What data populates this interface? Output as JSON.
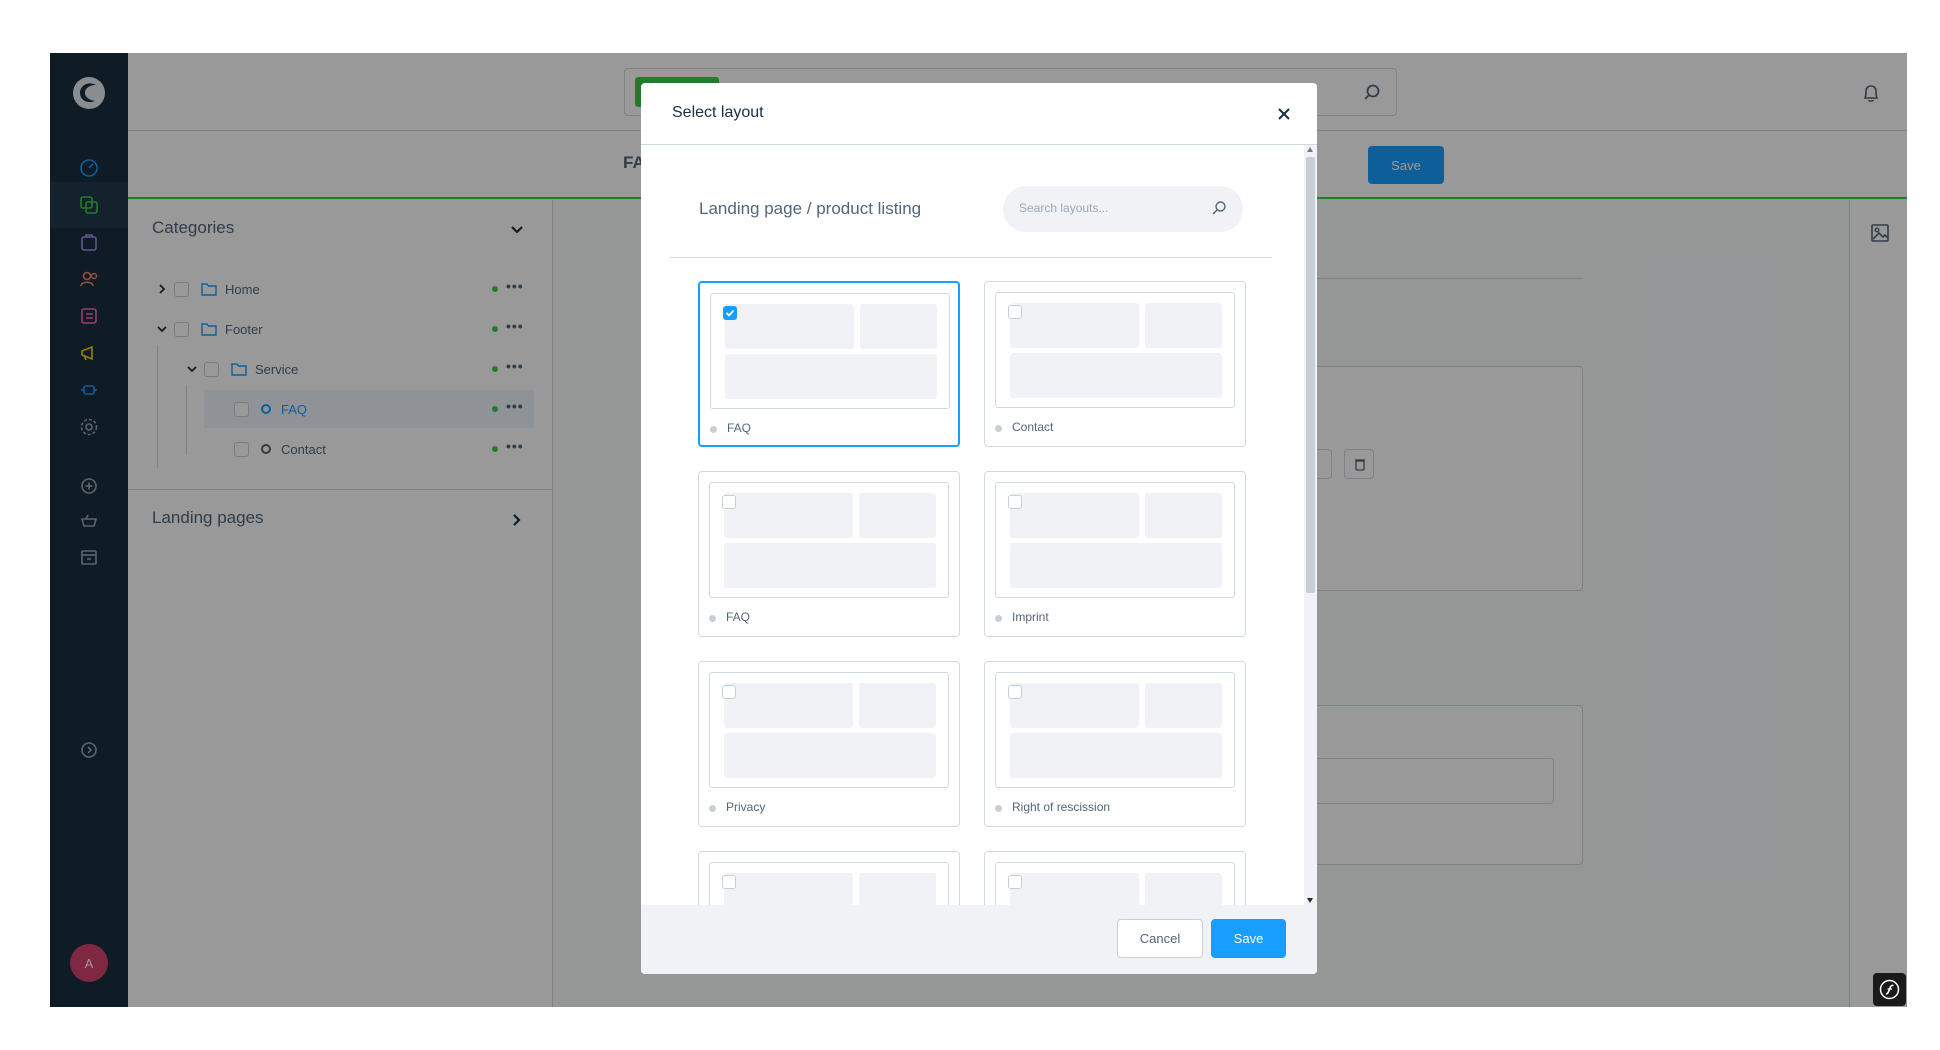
{
  "header": {
    "page_title": "FA",
    "save_label": "Save"
  },
  "tree": {
    "categories_label": "Categories",
    "landing_pages_label": "Landing pages",
    "nodes": [
      {
        "label": "Home"
      },
      {
        "label": "Footer"
      },
      {
        "label": "Service"
      },
      {
        "label": "FAQ"
      },
      {
        "label": "Contact"
      }
    ]
  },
  "user": {
    "avatar_initial": "A"
  },
  "modal": {
    "title": "Select layout",
    "subtitle": "Landing page / product listing",
    "search_placeholder": "Search layouts...",
    "layouts": [
      {
        "name": "FAQ",
        "selected": true
      },
      {
        "name": "Contact",
        "selected": false
      },
      {
        "name": "FAQ",
        "selected": false
      },
      {
        "name": "Imprint",
        "selected": false
      },
      {
        "name": "Privacy",
        "selected": false
      },
      {
        "name": "Right of rescission",
        "selected": false
      }
    ],
    "cancel_label": "Cancel",
    "save_label": "Save"
  },
  "colors": {
    "nav_bg": "#1a2f40",
    "accent": "#189eff",
    "active_green": "#37d046",
    "avatar": "#d6426f"
  },
  "icons": [
    "shopware-logo-icon",
    "dashboard-icon",
    "catalog-icon",
    "orders-icon",
    "customers-icon",
    "content-icon",
    "marketing-icon",
    "extensions-icon",
    "settings-icon",
    "add-icon",
    "basket-icon",
    "store-icon",
    "help-icon",
    "bell-icon",
    "search-icon",
    "close-icon",
    "image-icon",
    "symfony-icon"
  ]
}
